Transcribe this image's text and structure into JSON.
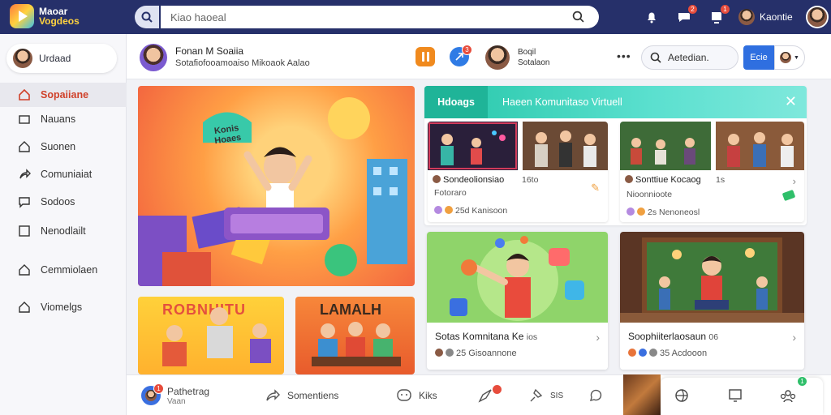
{
  "app": {
    "logo_line1": "Maoar",
    "logo_line2": "Vogdeos"
  },
  "search": {
    "placeholder": "Kiao haoeal"
  },
  "topbar": {
    "notif_badge": "2",
    "chat_badge": "1",
    "user_name": "Kaontie"
  },
  "sidebar": {
    "profile_name": "Urdaad",
    "items": [
      {
        "label": "Sopaiiane",
        "icon": "home-icon",
        "active": true
      },
      {
        "label": "Nauans",
        "icon": "square-icon",
        "active": false
      },
      {
        "label": "Suonen",
        "icon": "house-icon",
        "active": false
      },
      {
        "label": "Comuniaiat",
        "icon": "share-icon",
        "active": false
      },
      {
        "label": "Sodoos",
        "icon": "chat-icon",
        "active": false
      },
      {
        "label": "Nenodlailt",
        "icon": "box-icon",
        "active": false
      },
      {
        "label": "Cemmiolaen",
        "icon": "home-icon",
        "active": false
      },
      {
        "label": "Viomelgs",
        "icon": "home-icon",
        "active": false
      }
    ]
  },
  "header": {
    "channel_title": "Fonan M Soaiia",
    "channel_subtitle": "Sotafiofooamoaiso Mikoaok Aalao",
    "blue_badge": "3",
    "person_line1": "Boqil",
    "person_line2": "Sotalaon",
    "search_label": "Aetedian.",
    "action_button": "Ecie"
  },
  "hero": {
    "sign_text": "Konis Hoaes"
  },
  "thumbs": {
    "left_banner": "ROBNHITU",
    "right_banner": "LAMALH"
  },
  "room": {
    "tab_label": "Hdoags",
    "title": "Haeen Komunitaso Virtuell",
    "close": "✕",
    "cards": [
      {
        "title": "Sondeolionsiao",
        "tag": "16to",
        "sub": "Fotoraro",
        "meta": "25d Kanisoon"
      },
      {
        "title": "Sonttiue Kocaog",
        "tag": "1s",
        "sub": "Nioonnioote",
        "meta": "2s Nenoneosl"
      }
    ]
  },
  "features": [
    {
      "title": "Sotas Komnitana Ke",
      "tag": "ios",
      "meta": "25 Gisoannone"
    },
    {
      "title": "Soophiiterlaosaun",
      "tag": "06",
      "meta": "35 Acdooon"
    }
  ],
  "bottom": {
    "badge1": "1",
    "item1_label": "Pathetrag",
    "item1_sub": "Vaan",
    "item2_label": "Somentiens",
    "item3_label": "Kiks",
    "item5_label": "SIS",
    "badge_right": "1"
  },
  "colors": {
    "topbar": "#26306a",
    "accent_red": "#d0412a",
    "room_teal": "#25c6a8",
    "button_blue": "#2f6fe0"
  }
}
